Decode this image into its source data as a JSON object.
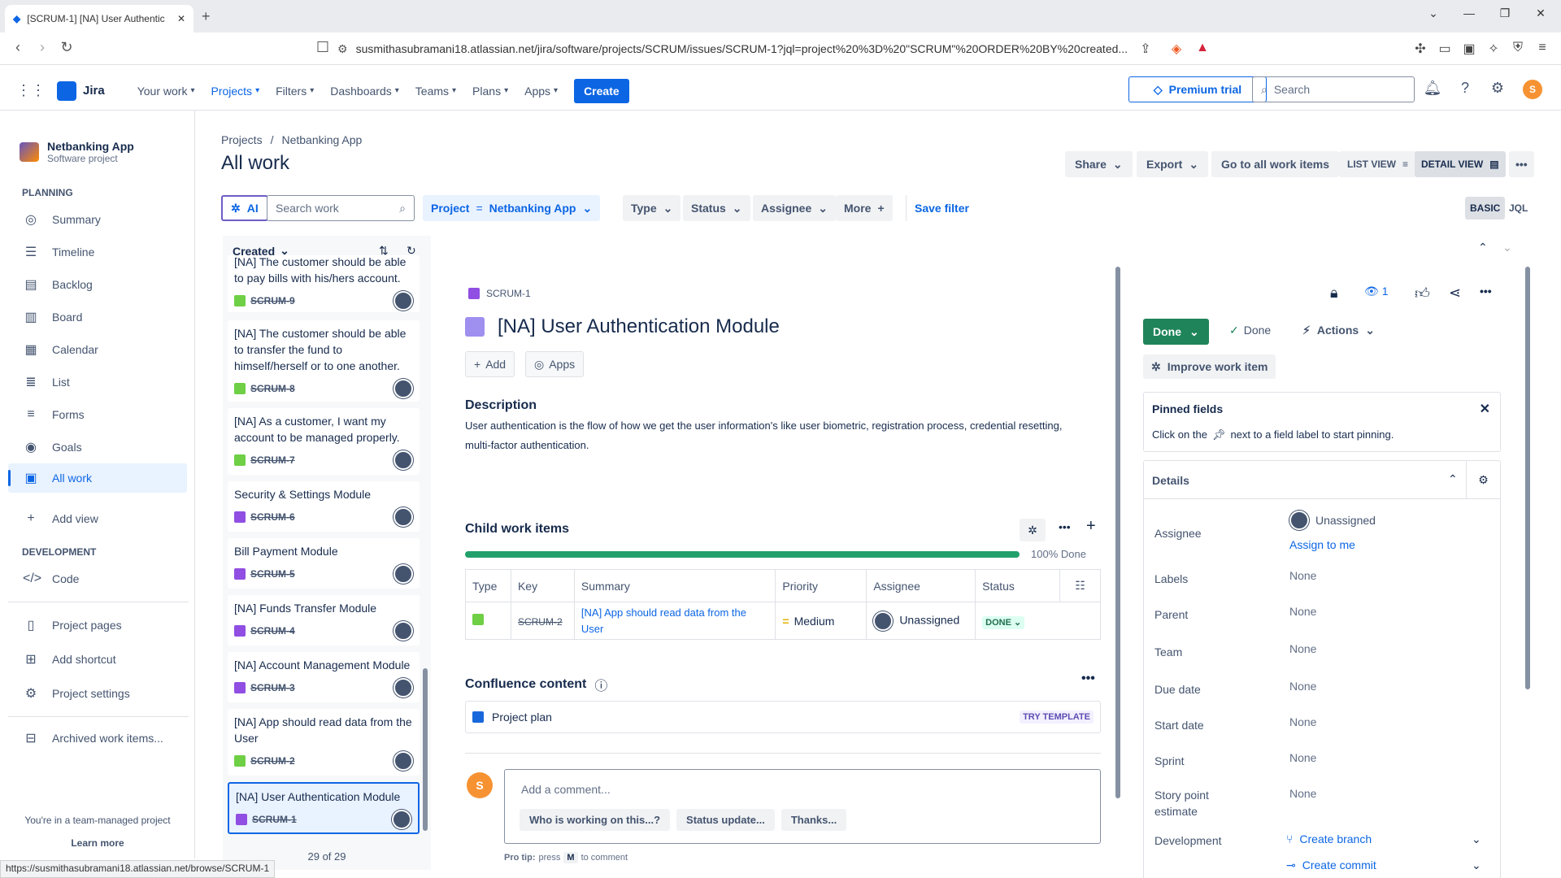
{
  "browser": {
    "tab_title": "[SCRUM-1] [NA] User Authentic",
    "url": "susmithasubramani18.atlassian.net/jira/software/projects/SCRUM/issues/SCRUM-1?jql=project%20%3D%20\"SCRUM\"%20ORDER%20BY%20created...",
    "status_url": "https://susmithasubramani18.atlassian.net/browse/SCRUM-1"
  },
  "topnav": {
    "logo": "Jira",
    "items": [
      "Your work",
      "Projects",
      "Filters",
      "Dashboards",
      "Teams",
      "Plans",
      "Apps"
    ],
    "create": "Create",
    "premium": "Premium trial",
    "search_placeholder": "Search",
    "avatar_letter": "S"
  },
  "sidebar": {
    "project_name": "Netbanking App",
    "project_type": "Software project",
    "planning_heading": "PLANNING",
    "planning_items": [
      "Summary",
      "Timeline",
      "Backlog",
      "Board",
      "Calendar",
      "List",
      "Forms",
      "Goals",
      "All work"
    ],
    "add_view": "Add view",
    "development_heading": "DEVELOPMENT",
    "code": "Code",
    "bottom_items": [
      "Project pages",
      "Add shortcut",
      "Project settings"
    ],
    "archived": "Archived work items...",
    "team_managed": "You're in a team-managed project",
    "learn_more": "Learn more"
  },
  "header": {
    "breadcrumb": [
      "Projects",
      "/",
      "Netbanking App"
    ],
    "title": "All work",
    "share": "Share",
    "export": "Export",
    "go_all": "Go to all work items",
    "list_view": "LIST VIEW",
    "detail_view": "DETAIL VIEW"
  },
  "filters": {
    "ai": "AI",
    "search_placeholder": "Search work",
    "project_label": "Project",
    "project_op": "=",
    "project_value": "Netbanking App",
    "type": "Type",
    "status": "Status",
    "assignee": "Assignee",
    "more": "More",
    "save_filter": "Save filter",
    "basic": "BASIC",
    "jql": "JQL"
  },
  "list": {
    "sort_label": "Created",
    "count": "29 of 29",
    "cards": [
      {
        "summary": "[NA] The customer should be able to pay bills with his/hers account.",
        "key": "SCRUM-9",
        "kind": "story"
      },
      {
        "summary": "[NA] The customer should be able to transfer the fund to himself/herself or to one another.",
        "key": "SCRUM-8",
        "kind": "story"
      },
      {
        "summary": "[NA] As a customer, I want my account to be managed properly.",
        "key": "SCRUM-7",
        "kind": "story"
      },
      {
        "summary": "Security & Settings Module",
        "key": "SCRUM-6",
        "kind": "epic"
      },
      {
        "summary": "Bill Payment Module",
        "key": "SCRUM-5",
        "kind": "epic"
      },
      {
        "summary": "[NA] Funds Transfer Module",
        "key": "SCRUM-4",
        "kind": "epic"
      },
      {
        "summary": "[NA] Account Management Module",
        "key": "SCRUM-3",
        "kind": "epic"
      },
      {
        "summary": "[NA] App should read data from the User",
        "key": "SCRUM-2",
        "kind": "story"
      },
      {
        "summary": "[NA] User Authentication Module",
        "key": "SCRUM-1",
        "kind": "epic"
      }
    ]
  },
  "detail": {
    "key": "SCRUM-1",
    "title": "[NA] User Authentication Module",
    "add": "Add",
    "apps": "Apps",
    "description_heading": "Description",
    "description": "User authentication is the flow of how we get the user information's like user biometric, registration process, credential resetting, multi-factor authentication.",
    "child_heading": "Child work items",
    "progress_pct": 100,
    "progress_label": "100% Done",
    "child_columns": [
      "Type",
      "Key",
      "Summary",
      "Priority",
      "Assignee",
      "Status"
    ],
    "child_rows": [
      {
        "key": "SCRUM-2",
        "summary": "[NA] App should read data from the User",
        "priority": "Medium",
        "assignee": "Unassigned",
        "status": "DONE"
      }
    ],
    "confluence_heading": "Confluence content",
    "confluence_item": "Project plan",
    "try_template": "TRY TEMPLATE",
    "comment_avatar": "S",
    "comment_placeholder": "Add a comment...",
    "suggestions": [
      "Who is working on this...?",
      "Status update...",
      "Thanks..."
    ],
    "pro_tip_prefix": "Pro tip:",
    "pro_tip_press": "press",
    "pro_tip_key": "M",
    "pro_tip_suffix": "to comment"
  },
  "right": {
    "watch_count": "1",
    "status_btn": "Done",
    "done_label": "Done",
    "actions": "Actions",
    "improve": "Improve work item",
    "pinned_heading": "Pinned fields",
    "pinned_text_1": "Click on the",
    "pinned_text_2": "next to a field label to start pinning.",
    "details_heading": "Details",
    "fields": [
      {
        "label": "Assignee",
        "value": "Unassigned"
      },
      {
        "label": "Labels",
        "value": "None"
      },
      {
        "label": "Parent",
        "value": "None"
      },
      {
        "label": "Team",
        "value": "None"
      },
      {
        "label": "Due date",
        "value": "None"
      },
      {
        "label": "Start date",
        "value": "None"
      },
      {
        "label": "Sprint",
        "value": "None"
      },
      {
        "label": "Story point estimate",
        "value": "None"
      },
      {
        "label": "Development",
        "value": ""
      }
    ],
    "assign_to_me": "Assign to me",
    "create_branch": "Create branch",
    "create_commit": "Create commit"
  },
  "colors": {
    "accent": "#0c66e4",
    "done_green": "#1f845a",
    "epic": "#904ee2",
    "story": "#6fcf45"
  }
}
